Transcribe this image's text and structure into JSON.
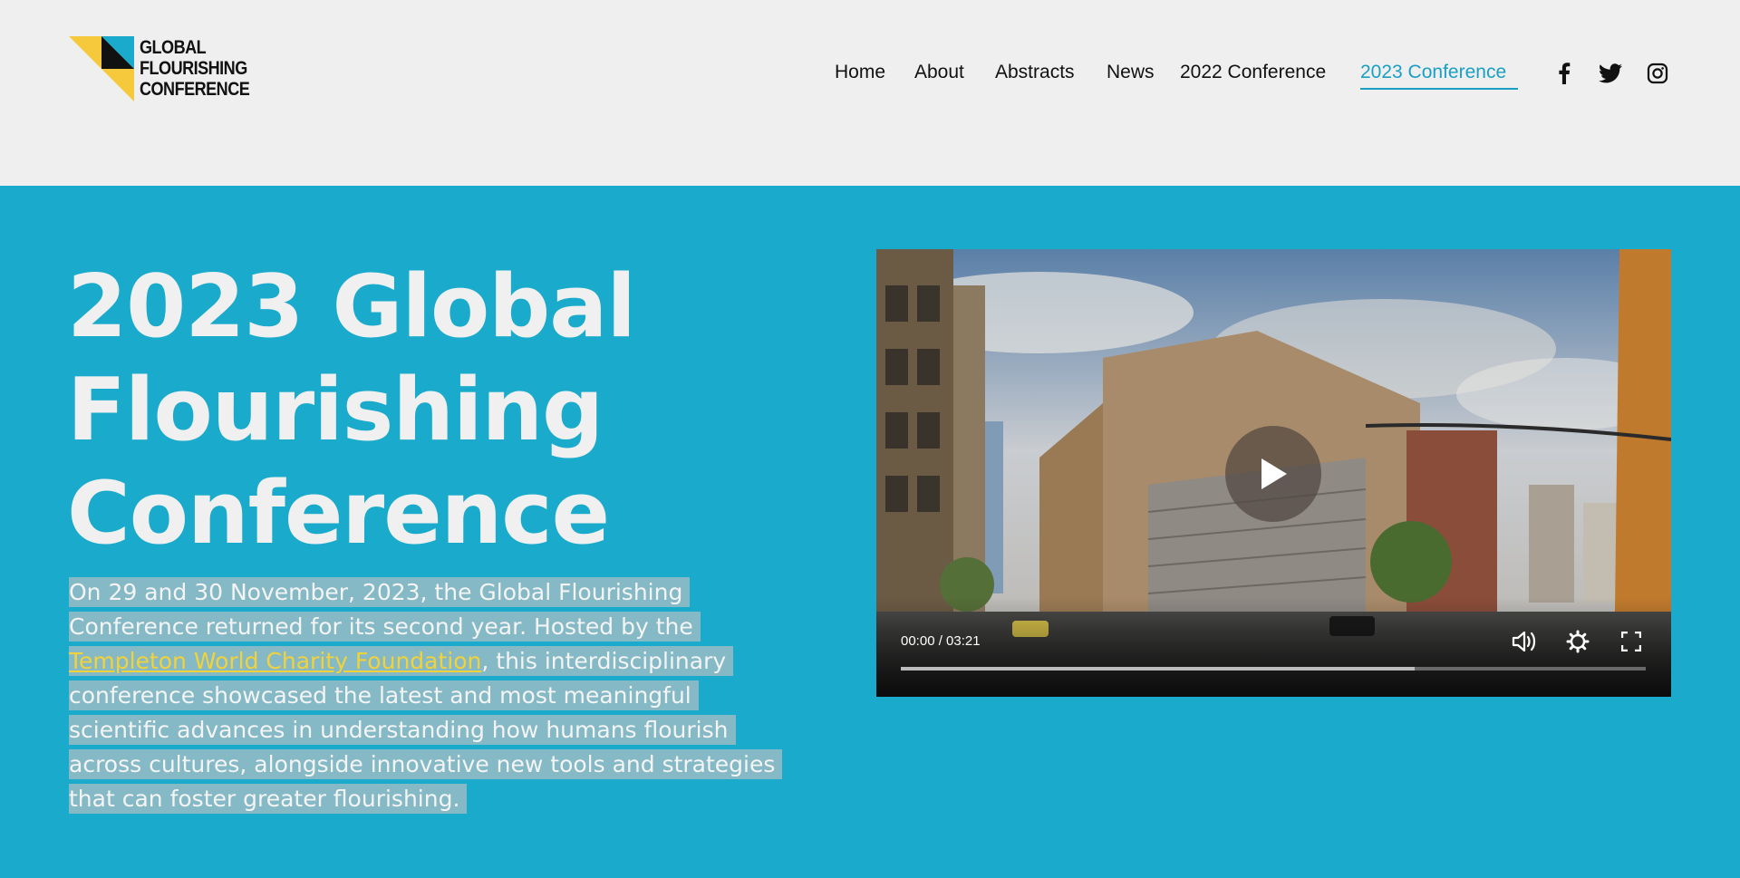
{
  "brand": {
    "logo_lines": [
      "GLOBAL",
      "FLOURISHING",
      "CONFERENCE"
    ],
    "colors": {
      "yellow": "#f5c93b",
      "blue": "#1aabcc",
      "black": "#111111"
    }
  },
  "nav": {
    "items": [
      {
        "label": "Home"
      },
      {
        "label": "About"
      },
      {
        "label": "Abstracts"
      },
      {
        "label": "News"
      },
      {
        "label": "2022 Conference"
      },
      {
        "label": "2023 Conference",
        "active": true
      }
    ],
    "social": [
      "facebook-icon",
      "twitter-icon",
      "instagram-icon"
    ]
  },
  "hero": {
    "title_lines": [
      "2023 Global",
      "Flourishing",
      "Conference"
    ],
    "body_before_link": "On 29 and 30 November, 2023, the Global Flourishing Conference returned for its second year. Hosted by the ",
    "link_text": "Templeton World Charity Foundation",
    "body_after_link": ", this interdisciplinary conference showcased the latest and most meaningful scientific advances in understanding how humans flourish across cultures, alongside innovative new tools and strategies that can foster greater flourishing."
  },
  "video": {
    "time_display": "00:00 / 03:21",
    "progress": 0,
    "buffered": 0.69,
    "controls": [
      "play-icon",
      "volume-icon",
      "settings-icon",
      "fullscreen-icon"
    ]
  }
}
